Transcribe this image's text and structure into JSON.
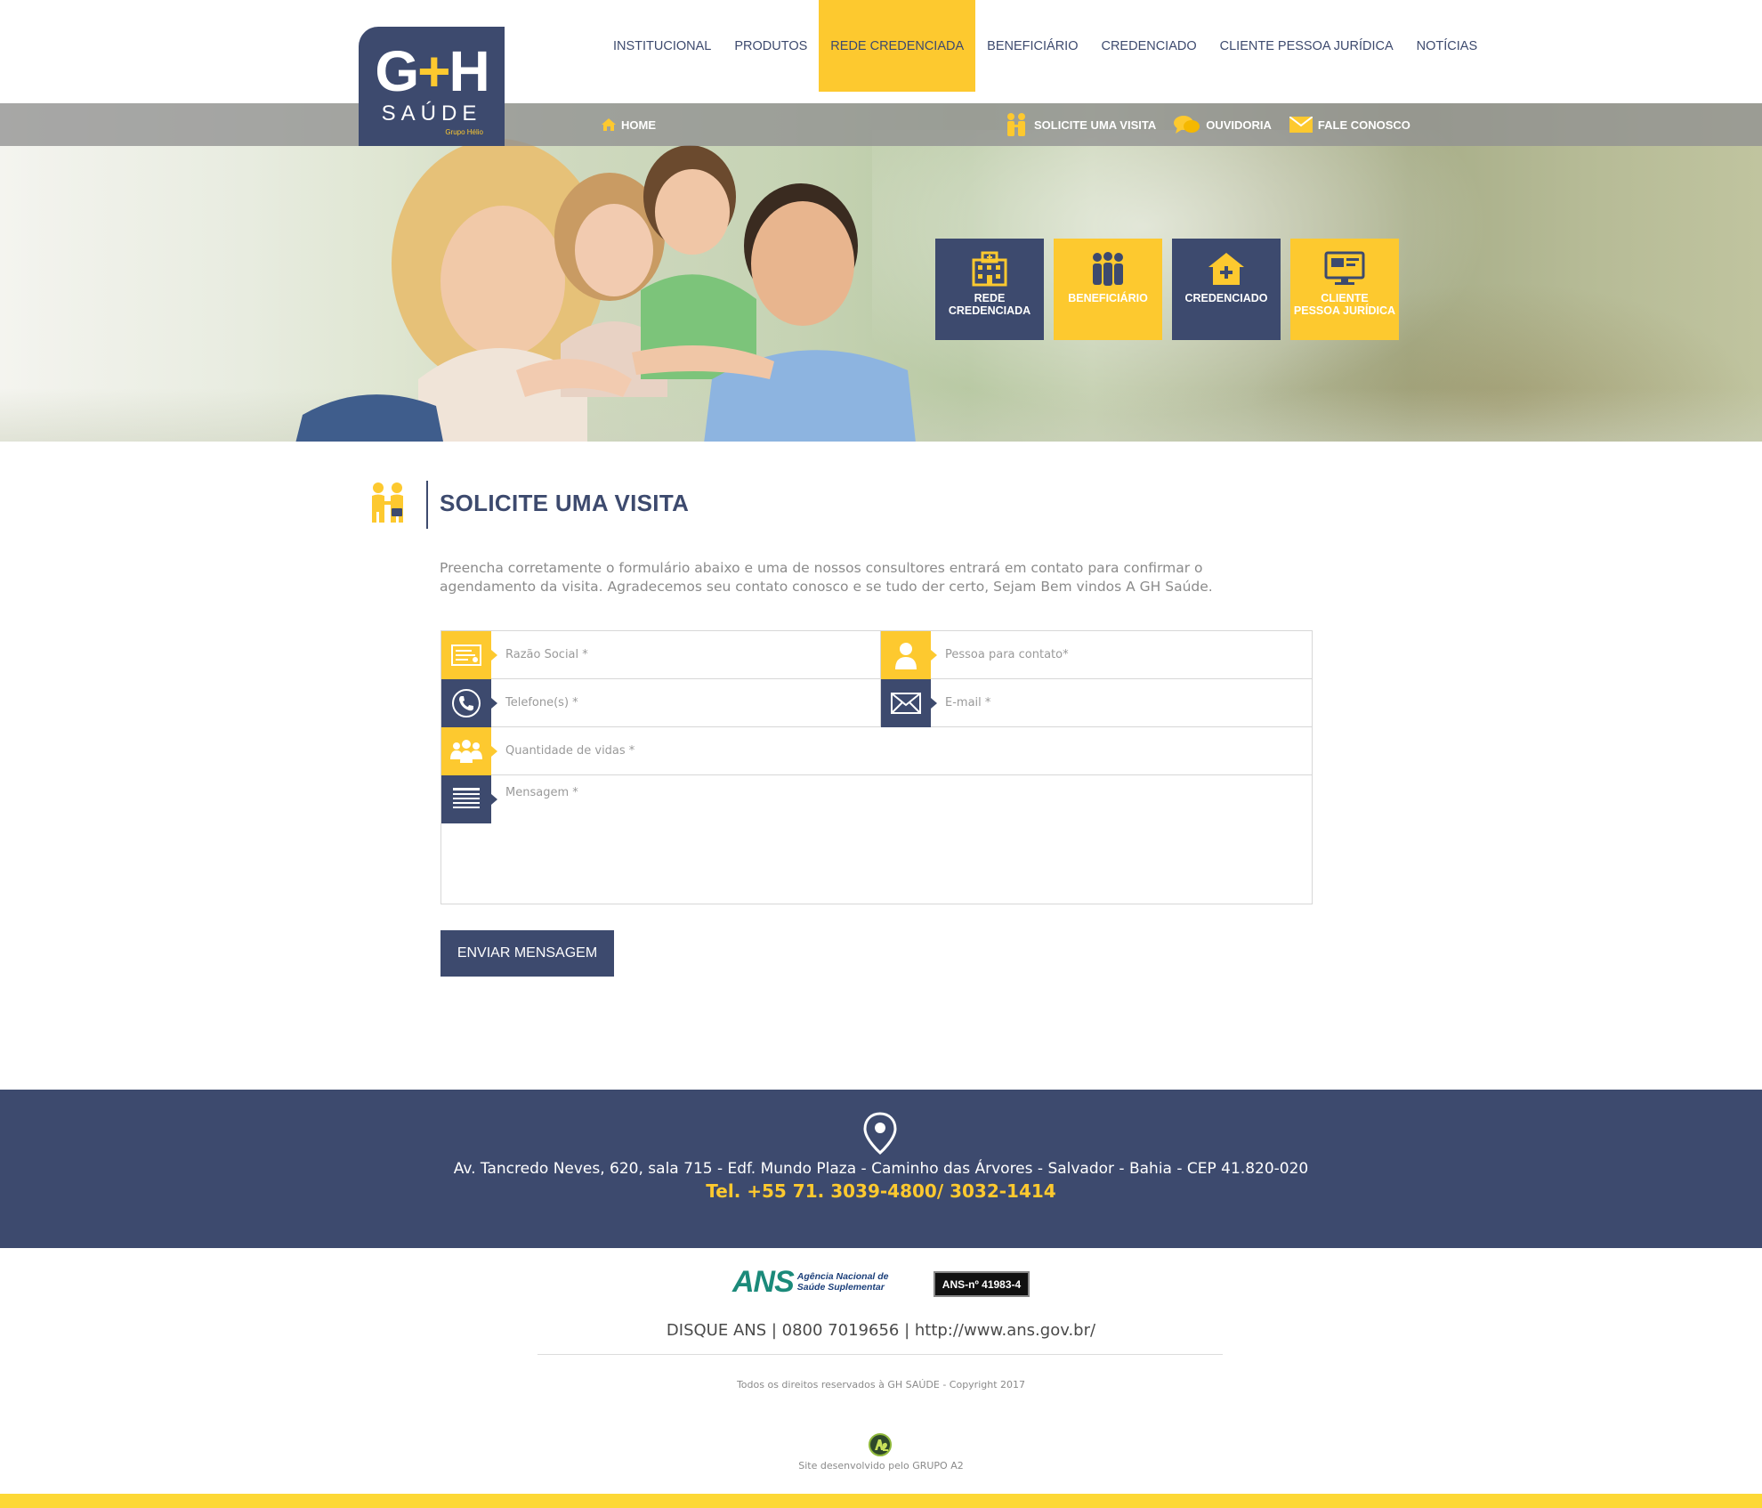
{
  "brand": {
    "logo_main": "G",
    "logo_plus": "+",
    "logo_h": "H",
    "logo_sub": "SAÚDE",
    "logo_group": "Grupo Hélio"
  },
  "main_nav": [
    {
      "label": "INSTITUCIONAL",
      "active": false
    },
    {
      "label": "PRODUTOS",
      "active": false
    },
    {
      "label": "REDE CREDENCIADA",
      "active": true
    },
    {
      "label": "BENEFICIÁRIO",
      "active": false
    },
    {
      "label": "CREDENCIADO",
      "active": false
    },
    {
      "label": "CLIENTE PESSOA JURÍDICA",
      "active": false
    },
    {
      "label": "NOTÍCIAS",
      "active": false
    }
  ],
  "sub_nav": {
    "home": "HOME",
    "visit": "SOLICITE UMA VISITA",
    "ouvidoria": "OUVIDORIA",
    "contact": "FALE CONOSCO"
  },
  "tiles": [
    {
      "label": "REDE\nCREDENCIADA",
      "icon": "hospital-icon",
      "color": "navy"
    },
    {
      "label": "BENEFICIÁRIO",
      "icon": "people-icon",
      "color": "yellow"
    },
    {
      "label": "CREDENCIADO",
      "icon": "medical-house-icon",
      "color": "navy"
    },
    {
      "label": "CLIENTE\nPESSOA JURÍDICA",
      "icon": "monitor-icon",
      "color": "yellow"
    }
  ],
  "page": {
    "title": "SOLICITE UMA VISITA",
    "intro": "Preencha corretamente o formulário abaixo e uma de nossos consultores entrará em contato para confirmar o agendamento da visita. Agradecemos seu contato conosco e se tudo der certo, Sejam Bem vindos A GH Saúde."
  },
  "form": {
    "razao_social": {
      "placeholder": "Razão Social *",
      "value": ""
    },
    "contato": {
      "placeholder": "Pessoa para contato*",
      "value": ""
    },
    "telefone": {
      "placeholder": "Telefone(s) *",
      "value": ""
    },
    "email": {
      "placeholder": "E-mail *",
      "value": ""
    },
    "vidas": {
      "placeholder": "Quantidade de vidas *",
      "value": ""
    },
    "mensagem": {
      "placeholder": "Mensagem *",
      "value": ""
    },
    "submit_label": "ENVIAR MENSAGEM"
  },
  "footer": {
    "address": "Av. Tancredo Neves, 620, sala 715 - Edf. Mundo Plaza - Caminho das Árvores - Salvador - Bahia - CEP 41.820-020",
    "phone": "Tel. +55 71. 3039-4800/ 3032-1414",
    "ans_logo": "ANS",
    "ans_logo_line1": "Agência Nacional de",
    "ans_logo_line2": "Saúde Suplementar",
    "ans_badge": "ANS-nº 41983-4",
    "disque": "DISQUE ANS | 0800 7019656 | http://www.ans.gov.br/",
    "copyright": "Todos os direitos reservados à GH SAÚDE - Copyright 2017",
    "credit": "Site desenvolvido pelo GRUPO A2"
  },
  "colors": {
    "navy": "#3d4a6e",
    "yellow": "#fdc92f",
    "gray_bar": "#919191"
  }
}
